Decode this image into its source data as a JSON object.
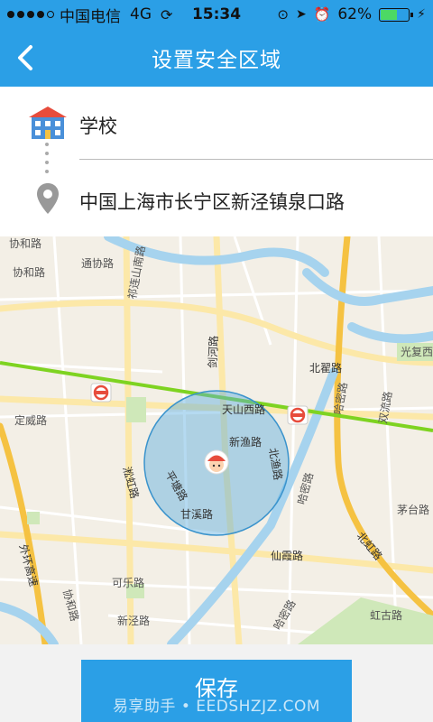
{
  "status_bar": {
    "carrier": "中国电信",
    "network": "4G",
    "time": "15:34",
    "battery": "62%",
    "battery_level": 0.62,
    "icons": [
      "sync-icon",
      "lock-rotation-icon",
      "location-arrow-icon",
      "alarm-icon",
      "battery-icon",
      "charging-icon"
    ]
  },
  "nav": {
    "title": "设置安全区域",
    "back_icon": "chevron-left-icon"
  },
  "form": {
    "school_name": "学校",
    "school_icon": "school-building-icon",
    "address": "中国上海市长宁区新泾镇泉口路",
    "address_icon": "location-pin-icon"
  },
  "map": {
    "labels": [
      "协和路",
      "通协路",
      "祁连山南路",
      "协和路",
      "光复西",
      "剑河路",
      "北翟路",
      "天山西路",
      "哈密路",
      "淞虹路",
      "定威路",
      "新渔路",
      "北渔路",
      "双流路",
      "平塘路",
      "甘溪路",
      "哈密路",
      "茅台路",
      "外环高速",
      "北虹路",
      "仙霞路",
      "协和路",
      "可乐路",
      "新泾路",
      "虹古路",
      "哈密路"
    ],
    "safe_zone_color": "#5aaee0",
    "avatar_icon": "child-avatar-icon",
    "metro_icon": "metro-station-icon"
  },
  "footer": {
    "save_label": "保存",
    "watermark": "易享助手 • EEDSHZJZ.COM"
  },
  "colors": {
    "accent": "#2b9fe6",
    "metro_line": "#7ed321",
    "highway": "#f5c242"
  }
}
